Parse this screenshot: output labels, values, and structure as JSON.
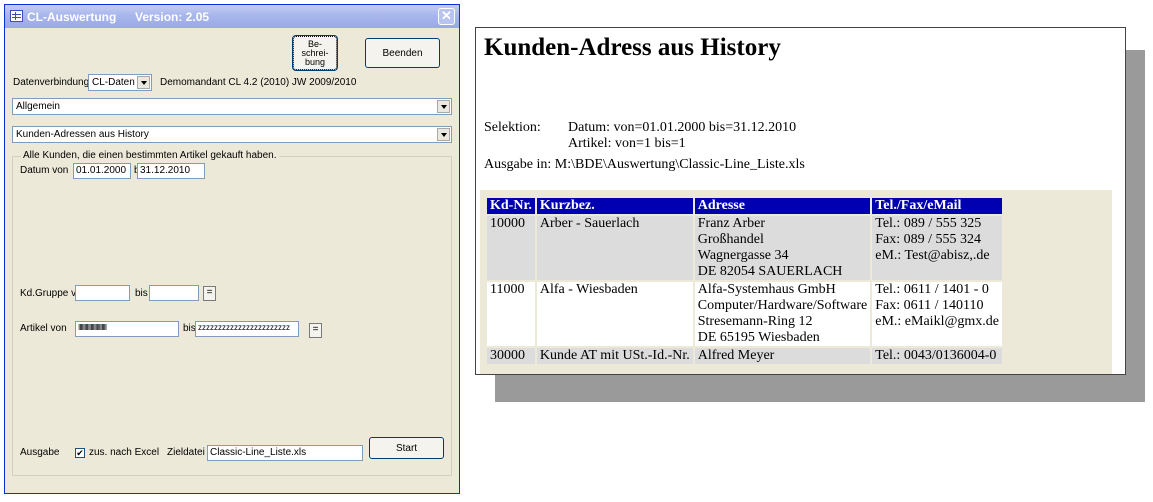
{
  "dialog": {
    "title": "CL-Auswertung",
    "version": "Version: 2.05",
    "close_glyph": "✕",
    "btn_beschreibung": [
      "Be-",
      "schrei-",
      "bung"
    ],
    "btn_beenden": "Beenden",
    "datenverbindung_label": "Datenverbindung",
    "datenverbindung_value": "CL-Daten",
    "mandant_text": "Demomandant CL 4.2 (2010) JW 2009/2010",
    "category_value": "Allgemein",
    "report_value": "Kunden-Adressen aus History",
    "group_title": "Alle Kunden, die einen bestimmten Artikel gekauft haben.",
    "datum_label": "Datum von",
    "datum_from": "01.01.2000",
    "bis_label": "bis",
    "datum_to": "31.12.2010",
    "kdgruppe_label": "Kd.Gruppe v.",
    "kdgruppe_from": "",
    "kdgruppe_to": "",
    "equals_glyph": "=",
    "artikel_label": "Artikel von",
    "artikel_from": "IIIIIIIIIIIIIIIIIIIIIII",
    "artikel_to": "zzzzzzzzzzzzzzzzzzzzzzz",
    "ausgabe_label": "Ausgabe",
    "excel_checkbox_label": "zus. nach Excel",
    "excel_checked": "✔",
    "zieldatei_label": "Zieldatei",
    "zieldatei_value": "Classic-Line_Liste.xls",
    "btn_start": "Start"
  },
  "report": {
    "title": "Kunden-Adress aus History",
    "selektion_label": "Selektion:",
    "selektion_datum": "Datum: von=01.01.2000 bis=31.12.2010",
    "selektion_artikel": "Artikel: von=1 bis=1",
    "ausgabe": "Ausgabe in: M:\\BDE\\Auswertung\\Classic-Line_Liste.xls",
    "columns": [
      "Kd-Nr.",
      "Kurzbez.",
      "Adresse",
      "Tel./Fax/eMail"
    ],
    "rows": [
      {
        "kdnr": "10000",
        "kurzbez": "Arber - Sauerlach",
        "adresse": [
          "Franz Arber",
          "Großhandel",
          "Wagnergasse 34",
          "DE 82054 SAUERLACH"
        ],
        "kontakt": [
          "Tel.: 089 / 555 325",
          "Fax: 089 / 555 324",
          "eM.: Test@abisz,.de"
        ]
      },
      {
        "kdnr": "11000",
        "kurzbez": "Alfa - Wiesbaden",
        "adresse": [
          "Alfa-Systemhaus GmbH",
          "Computer/Hardware/Software",
          "Stresemann-Ring 12",
          "DE 65195 Wiesbaden"
        ],
        "kontakt": [
          "Tel.: 0611 / 1401 - 0",
          "Fax: 0611 / 140110",
          "eM.: eMaikl@gmx.de"
        ]
      },
      {
        "kdnr": "30000",
        "kurzbez": "Kunde AT mit USt.-Id.-Nr.",
        "adresse": [
          "Alfred Meyer"
        ],
        "kontakt": [
          "Tel.: 0043/0136004-0"
        ]
      }
    ]
  }
}
